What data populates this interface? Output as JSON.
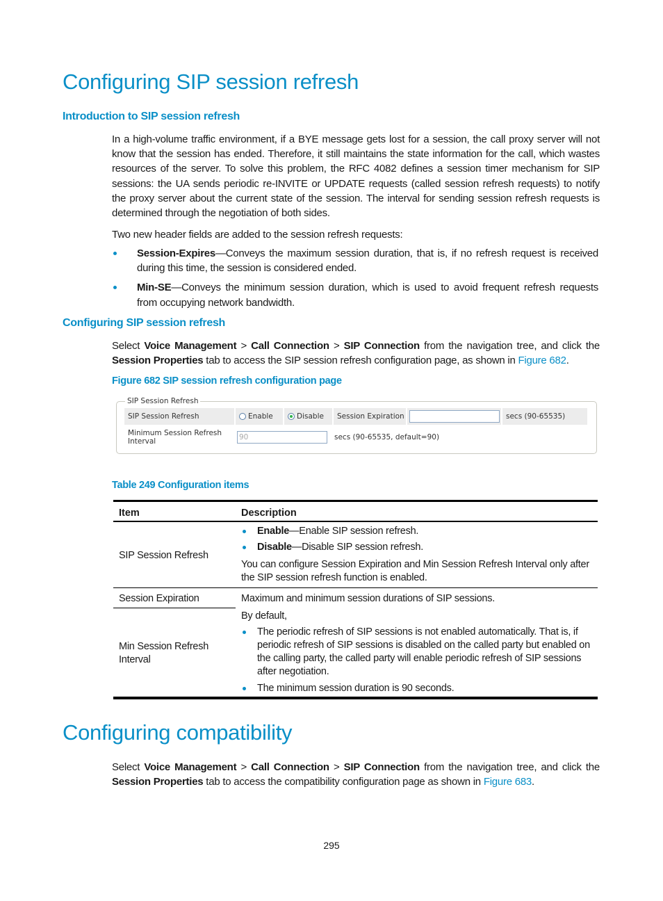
{
  "section1": {
    "title": "Configuring SIP session refresh",
    "intro": {
      "heading": "Introduction to SIP session refresh",
      "paragraph": "In a high-volume traffic environment, if a BYE message gets lost for a session, the call proxy server will not know that the session has ended. Therefore, it still maintains the state information for the call, which wastes resources of the server. To solve this problem, the RFC 4082 defines a session timer mechanism for SIP sessions: the UA sends periodic re-INVITE or UPDATE requests (called session refresh requests) to notify the proxy server about the current state of the session. The interval for sending session refresh requests is determined through the negotiation of both sides.",
      "lead": "Two new header fields are added to the session refresh requests:",
      "bullets": [
        {
          "term": "Session-Expires",
          "text": "—Conveys the maximum session duration, that is, if no refresh request is received during this time, the session is considered ended."
        },
        {
          "term": "Min-SE",
          "text": "—Conveys the minimum session duration, which is used to avoid frequent refresh requests from occupying network bandwidth."
        }
      ]
    },
    "configure": {
      "heading": "Configuring SIP session refresh",
      "p_select": "Select ",
      "nav1": "Voice Management",
      "sep": " > ",
      "nav2": "Call Connection",
      "nav3": "SIP Connection",
      "p_mid": " from the navigation tree, and click the ",
      "tab": "Session Properties",
      "p_end": " tab to access the SIP session refresh configuration page, as shown in ",
      "fig_link": "Figure 682",
      "period": ".",
      "figure_caption": "Figure 682 SIP session refresh configuration page"
    },
    "figure": {
      "legend": "SIP Session Refresh",
      "row1_label": "SIP Session Refresh",
      "radio_enable": "Enable",
      "radio_disable": "Disable",
      "selected": "Disable",
      "expiration_label": "Session Expiration",
      "expiration_value": "",
      "expiration_hint": "secs (90-65535)",
      "min_label": "Minimum Session Refresh Interval",
      "min_value": "90",
      "min_hint": "secs (90-65535, default=90)"
    },
    "table": {
      "caption": "Table 249 Configuration items",
      "headers": [
        "Item",
        "Description"
      ],
      "rows": [
        {
          "item": "SIP Session Refresh",
          "bullets": [
            {
              "term": "Enable",
              "text": "—Enable SIP session refresh."
            },
            {
              "term": "Disable",
              "text": "—Disable SIP session refresh."
            }
          ],
          "note": "You can configure Session Expiration and Min Session Refresh Interval only after the SIP session refresh function is enabled."
        },
        {
          "item": "Session Expiration",
          "shared_desc_line": "Maximum and minimum session durations of SIP sessions."
        },
        {
          "item": "Min Session Refresh Interval",
          "desc_lead": "By default,",
          "bullets": [
            "The periodic refresh of SIP sessions is not enabled automatically. That is, if periodic refresh of SIP sessions is disabled on the called party but enabled on the calling party, the called party will enable periodic refresh of SIP sessions after negotiation.",
            "The minimum session duration is 90 seconds."
          ]
        }
      ]
    }
  },
  "section2": {
    "title": "Configuring compatibility",
    "p_select": "Select ",
    "nav1": "Voice Management",
    "sep": " > ",
    "nav2": "Call Connection",
    "nav3": "SIP Connection",
    "p_mid": " from the navigation tree, and click the ",
    "tab": "Session Properties",
    "p_end": " tab to access the compatibility configuration page as shown in ",
    "fig_link": "Figure 683",
    "period": "."
  },
  "page_number": "295",
  "colors": {
    "accent": "#0a8fc7",
    "text": "#1a1a1a",
    "rule": "#000000"
  }
}
